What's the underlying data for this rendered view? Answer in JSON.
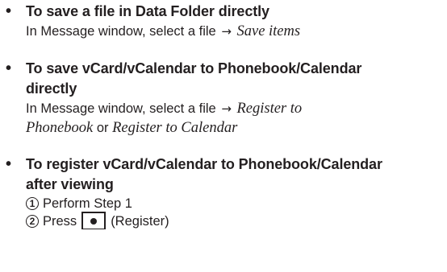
{
  "sections": [
    {
      "heading_lines": [
        "To save a file in Data Folder directly"
      ],
      "body": {
        "prefix": "In Message window, select a file",
        "arrow": "→",
        "italic1": "Save items"
      }
    },
    {
      "heading_lines": [
        "To save vCard/vCalendar to Phonebook/Calendar",
        "directly"
      ],
      "body": {
        "prefix": "In Message window, select a file",
        "arrow": "→",
        "italic1": "Register to",
        "italic2": "Phonebook",
        "connector": "or",
        "italic3": "Register to Calendar"
      }
    },
    {
      "heading_lines": [
        "To register vCard/vCalendar to Phonebook/Calendar",
        "after viewing"
      ],
      "steps": [
        {
          "num": "1",
          "text": "Perform Step 1"
        },
        {
          "num": "2",
          "prefix": "Press",
          "key_icon": "center-dot-key-icon",
          "text": "(Register)"
        }
      ]
    }
  ],
  "bullet_symbol": "•"
}
